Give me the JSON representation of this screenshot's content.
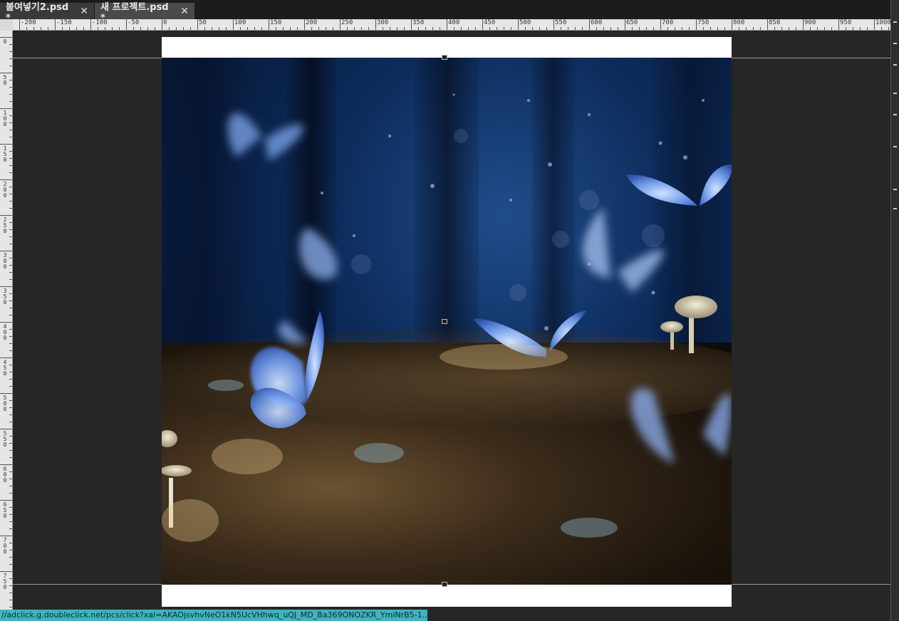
{
  "tabs": [
    {
      "label": "붙여넣기2.psd *",
      "close": "✕"
    },
    {
      "label": "새 프로젝트.psd *",
      "close": "✕"
    }
  ],
  "ruler": {
    "h_labels": [
      "-200",
      "-150",
      "-100",
      "-50",
      "0",
      "50",
      "100",
      "150",
      "200",
      "250",
      "300",
      "350",
      "400",
      "450",
      "500",
      "550",
      "600",
      "650",
      "700",
      "750",
      "800",
      "850",
      "900",
      "950",
      "1000"
    ],
    "v_labels": [
      "0",
      "50",
      "100",
      "150",
      "200",
      "250",
      "300",
      "350",
      "400",
      "450",
      "500",
      "550",
      "600",
      "650",
      "700",
      "750"
    ]
  },
  "canvas": {
    "document_background": "#ffffff",
    "image_subject": "blue butterflies over forest ground at night"
  },
  "status_bar": {
    "url": "//adclick.g.doubleclick.net/pcs/click?xai=AKAOjsvhvNeO1kN5UcVHhwq_uQJ_MD_Ba369ONOZKR_YmiNrB5-1..."
  },
  "colors": {
    "workspace": "#262626",
    "tab_active": "#4a4a4a",
    "status_url_bg": "#3fb4c0"
  }
}
